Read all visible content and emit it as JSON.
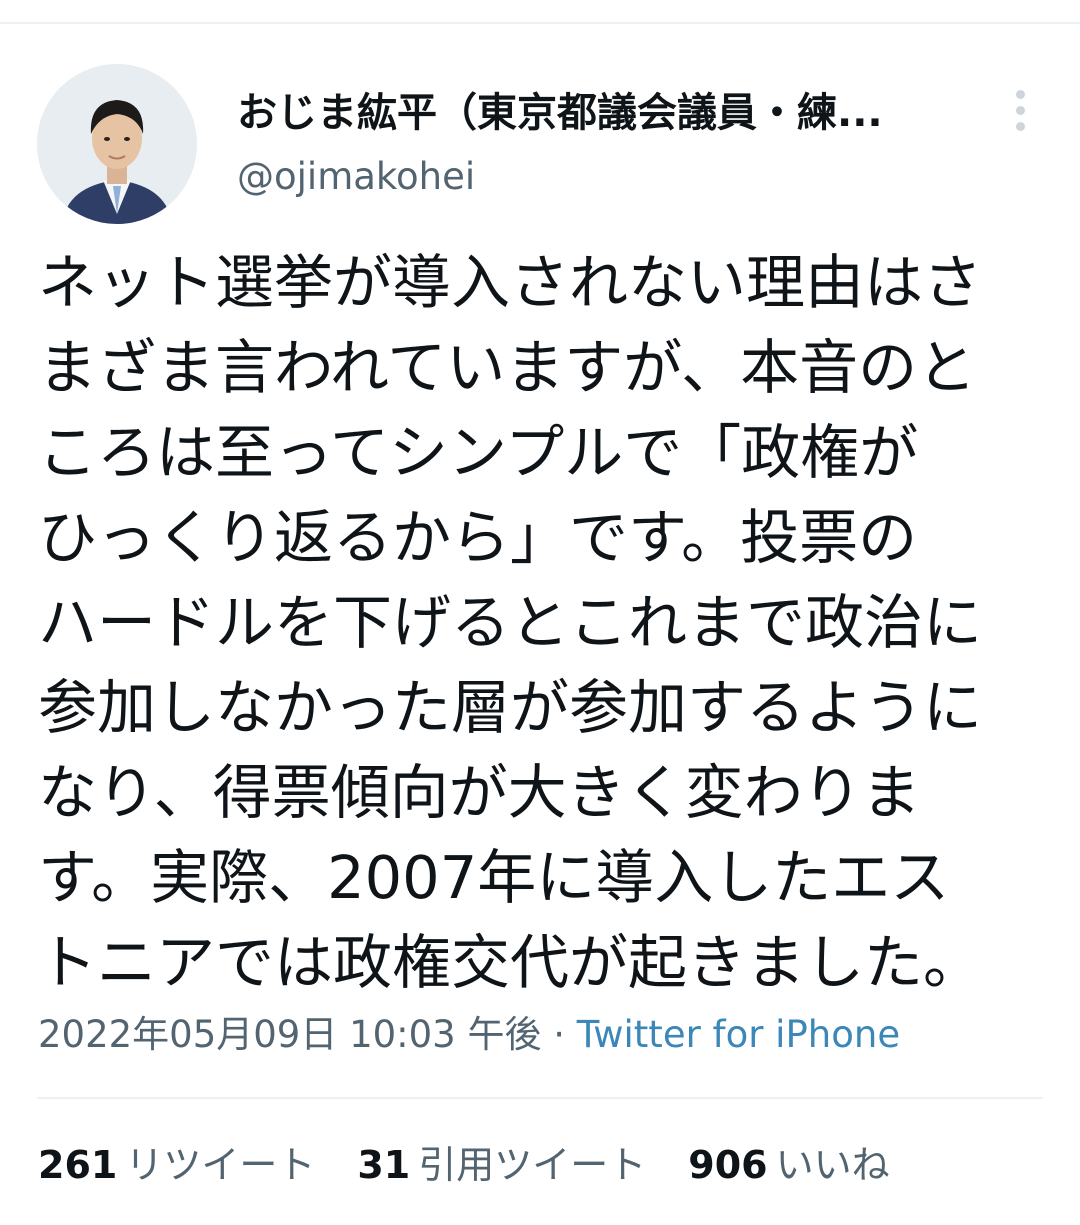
{
  "user": {
    "display_name": "おじま紘平（東京都議会議員・練...",
    "handle": "@ojimakohei"
  },
  "icons": {
    "avatar": "profile-photo",
    "more": "more-vertical-icon"
  },
  "tweet": {
    "lines": [
      "ネット選挙が導入されない理由はさ",
      "まざま言われていますが、本音のと",
      "ころは至ってシンプルで「政権が",
      "ひっくり返るから」です。投票の",
      "ハードルを下げるとこれまで政治に",
      "参加しなかった層が参加するように",
      "なり、得票傾向が大きく変わりま",
      "す。実際、2007年に導入したエス",
      "トニアでは政権交代が起きました。"
    ]
  },
  "meta": {
    "timestamp": "2022年05月09日 10:03 午後",
    "separator": " · ",
    "source": "Twitter for iPhone"
  },
  "stats": {
    "retweets": {
      "count": "261",
      "label": "リツイート"
    },
    "quotes": {
      "count": "31",
      "label": "引用ツイート"
    },
    "likes": {
      "count": "906",
      "label": "いいね"
    }
  },
  "colors": {
    "text": "#0f1419",
    "secondary": "#536471",
    "link": "#3a87b8",
    "divider": "#eef1f3"
  }
}
